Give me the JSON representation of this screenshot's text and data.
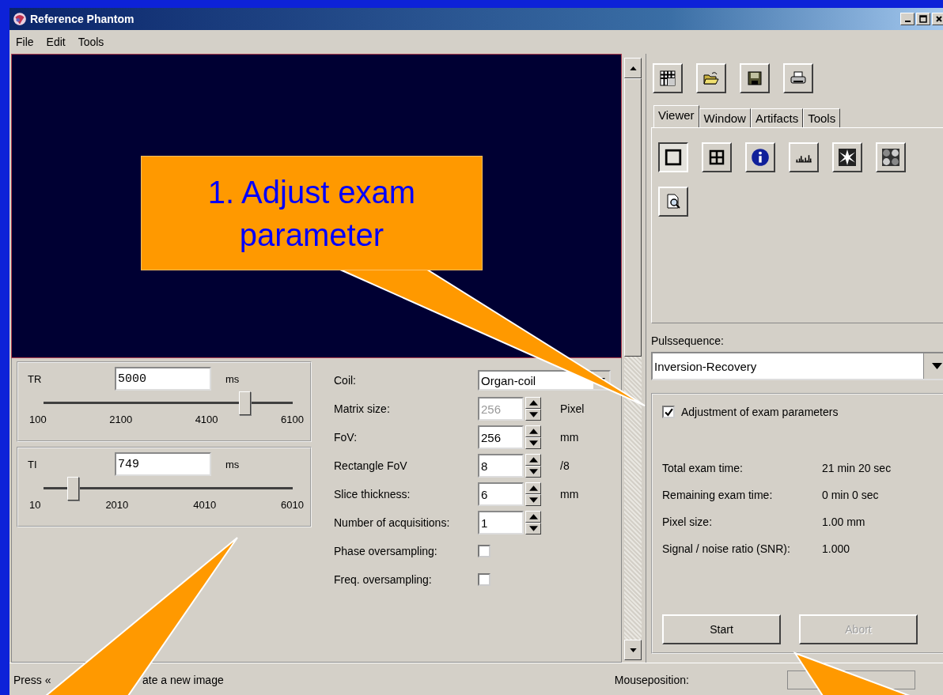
{
  "window": {
    "title": "Reference Phantom"
  },
  "menu": [
    "File",
    "Edit",
    "Tools"
  ],
  "tabs": [
    {
      "label": "Viewer",
      "selected": true
    },
    {
      "label": "Window",
      "selected": false
    },
    {
      "label": "Artifacts",
      "selected": false
    },
    {
      "label": "Tools",
      "selected": false
    }
  ],
  "viewer_tools": [
    {
      "kind": "single",
      "selected": true
    },
    {
      "kind": "quad",
      "selected": false
    },
    {
      "kind": "info",
      "selected": false
    },
    {
      "kind": "histogram",
      "selected": false
    },
    {
      "kind": "burst",
      "selected": false
    },
    {
      "kind": "mosaic",
      "selected": false
    },
    {
      "kind": "zoom",
      "selected": false
    }
  ],
  "sliders": [
    {
      "name": "TR",
      "value": "5000",
      "unit": "ms",
      "level": 0.81,
      "ticks": [
        "100",
        "2100",
        "4100",
        "6100"
      ]
    },
    {
      "name": "TI",
      "value": "749",
      "unit": "ms",
      "level": 0.12,
      "ticks": [
        "10",
        "2010",
        "4010",
        "6010"
      ]
    }
  ],
  "parameters": [
    {
      "kind": "dropdown",
      "label": "Coil:",
      "value": "Organ-coil"
    },
    {
      "kind": "spinner",
      "label": "Matrix size:",
      "value": "256",
      "unit": "Pixel",
      "disabled": true
    },
    {
      "kind": "spinner",
      "label": "FoV:",
      "value": "256",
      "unit": "mm",
      "disabled": false
    },
    {
      "kind": "spinner",
      "label": "Rectangle FoV",
      "value": "8",
      "unit": "/8",
      "disabled": false
    },
    {
      "kind": "spinner",
      "label": "Slice thickness:",
      "value": "6",
      "unit": "mm",
      "disabled": false
    },
    {
      "kind": "spinner",
      "label": "Number of acquisitions:",
      "value": "1",
      "disabled": false
    },
    {
      "kind": "checkbox",
      "label": "Phase oversampling:",
      "checked": false
    },
    {
      "kind": "checkbox",
      "label": "Freq. oversampling:",
      "checked": false
    }
  ],
  "pulse_sequence": {
    "label": "Pulssequence:",
    "value": "Inversion-Recovery"
  },
  "adjustment": {
    "label": "Adjustment of exam parameters",
    "checked": true
  },
  "stats": [
    {
      "label": "Total exam time:",
      "value": "21 min 20 sec"
    },
    {
      "label": "Remaining exam time:",
      "value": "0 min 0 sec"
    },
    {
      "label": "Pixel size:",
      "value": "1.00 mm"
    },
    {
      "label": "Signal / noise ratio (SNR):",
      "value": "1.000"
    }
  ],
  "buttons": [
    {
      "label": "Start",
      "disabled": false
    },
    {
      "label": "Abort",
      "disabled": true
    }
  ],
  "status_bar": {
    "message_parts": [
      "Press «",
      "ate a new image"
    ],
    "mouse_label": "Mouseposition:"
  },
  "callout": {
    "text": "1. Adjust exam parameter"
  }
}
